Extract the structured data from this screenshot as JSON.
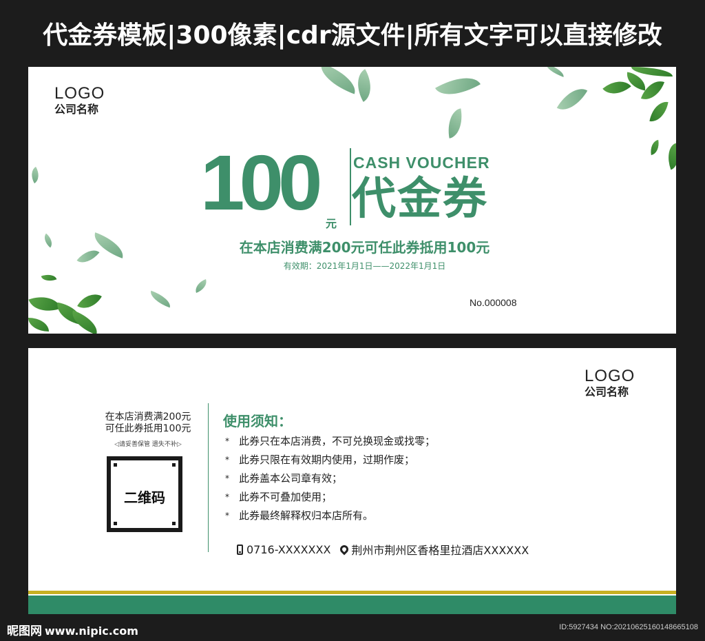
{
  "header": {
    "title": "代金券模板|300像素|cdr源文件|所有文字可以直接修改"
  },
  "front": {
    "logo": "LOGO",
    "company": "公司名称",
    "amount": "100",
    "unit": "元",
    "cash_voucher": "CASH VOUCHER",
    "voucher_cn": "代金券",
    "condition": "在本店消费满200元可任此券抵用100元",
    "validity": "有效期：2021年1月1日——2022年1月1日",
    "serial": "No.000008"
  },
  "back": {
    "logo": "LOGO",
    "company": "公司名称",
    "condition_line1": "在本店消费满200元",
    "condition_line2": "可任此券抵用100元",
    "keep_note": "◁请妥善保管  遗失不补▷",
    "qr_label": "二维码",
    "notice_title": "使用须知：",
    "notices": [
      "此券只在本店消费，不可兑换现金或找零；",
      "此券只限在有效期内使用，过期作废；",
      "此券盖本公司章有效；",
      "此券不可叠加使用；",
      "此券最终解释权归本店所有。"
    ],
    "phone": "0716-XXXXXXX",
    "address": "荆州市荆州区香格里拉酒店XXXXXX"
  },
  "watermark": {
    "brand": "昵图网",
    "site": "www.nipic.com",
    "id": "ID:5927434 NO:20210625160148665108"
  },
  "colors": {
    "accent_green": "#3e8f6a",
    "band_gold": "#c7b023",
    "band_green": "#2f8b67",
    "background": "#1c1c1c"
  }
}
